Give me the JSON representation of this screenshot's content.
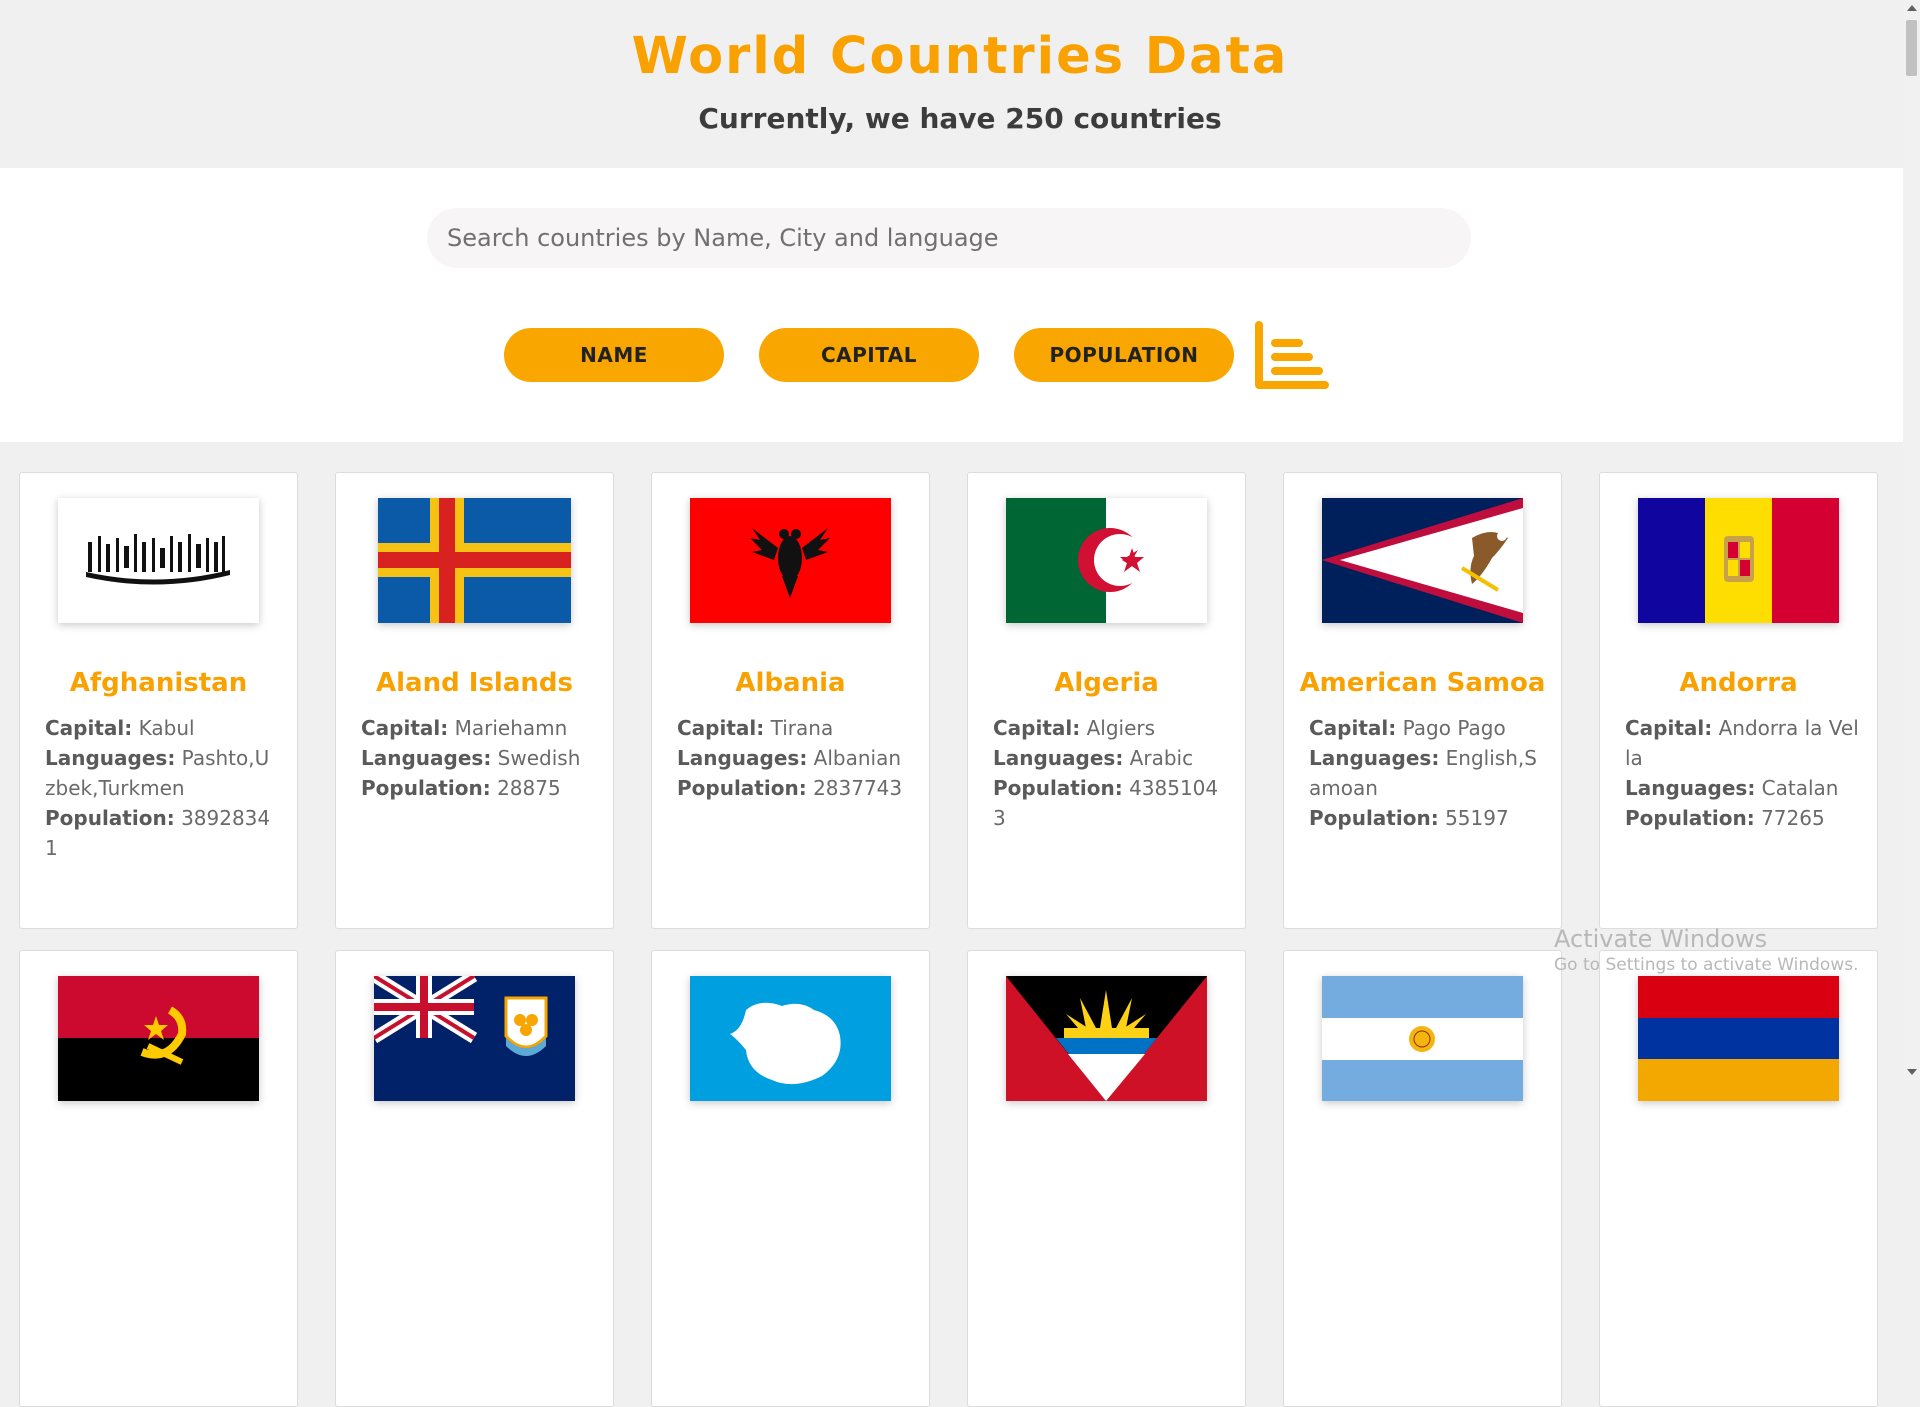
{
  "header": {
    "title": "World Countries Data",
    "subtitle": "Currently, we have 250 countries"
  },
  "search": {
    "placeholder": "Search countries by Name, City and language"
  },
  "sort_buttons": [
    "NAME",
    "CAPITAL",
    "POPULATION"
  ],
  "sort_icon": "bar-chart-icon",
  "labels": {
    "capital": "Capital:",
    "languages": "Languages:",
    "population": "Population:"
  },
  "countries": [
    {
      "name": "Afghanistan",
      "capital": "Kabul",
      "languages": "Pashto,Uzbek,Turkmen",
      "population": "38928341",
      "flag": "afghanistan-flag"
    },
    {
      "name": "Aland Islands",
      "capital": "Mariehamn",
      "languages": "Swedish",
      "population": "28875",
      "flag": "aland-flag"
    },
    {
      "name": "Albania",
      "capital": "Tirana",
      "languages": "Albanian",
      "population": "2837743",
      "flag": "albania-flag"
    },
    {
      "name": "Algeria",
      "capital": "Algiers",
      "languages": "Arabic",
      "population": "43851043",
      "flag": "algeria-flag"
    },
    {
      "name": "American Samoa",
      "capital": "Pago Pago",
      "languages": "English,Samoan",
      "population": "55197",
      "flag": "american-samoa-flag"
    },
    {
      "name": "Andorra",
      "capital": "Andorra la Vella",
      "languages": "Catalan",
      "population": "77265",
      "flag": "andorra-flag"
    }
  ],
  "second_row_flags": [
    "angola-flag",
    "anguilla-flag",
    "antarctica-flag",
    "antigua-flag",
    "argentina-flag",
    "armenia-flag"
  ],
  "colors": {
    "accent": "#f9a100",
    "button": "#f9a700",
    "background": "#f0f0f0"
  },
  "watermark": {
    "line1": "Activate Windows",
    "line2": "Go to Settings to activate Windows."
  }
}
